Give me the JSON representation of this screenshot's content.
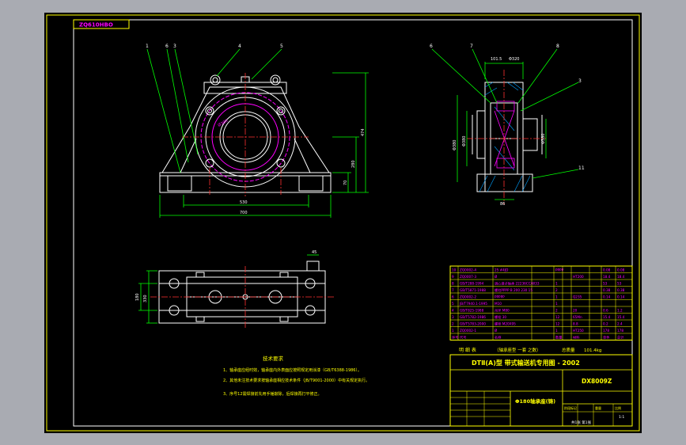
{
  "drawing_code": "ZQ610HBO",
  "colors": {
    "paper": "#000000",
    "outline": "#ffffff",
    "frame": "#ffff00",
    "label": "#ff00ff",
    "centerline": "#ff3030",
    "hatch": "#00a0ff",
    "leader": "#00ff00"
  },
  "front_view": {
    "callouts": [
      "1",
      "6",
      "3",
      "4",
      "5"
    ],
    "dims": {
      "width_base": "700",
      "width_bolt": "530",
      "height_total": "474",
      "height_center": "280",
      "height_base": "70",
      "bore": "Ø380"
    }
  },
  "side_view": {
    "callouts": [
      "6",
      "7",
      "8",
      "3",
      "11"
    ],
    "dims": {
      "top_a": "101.5",
      "top_b": "Φ320",
      "left_a": "Φ380",
      "left_b": "Φ380",
      "right": "Φ380",
      "bottom": "86"
    }
  },
  "top_view": {
    "dims": {
      "top": "45",
      "left_a": "330",
      "left_b": "180"
    }
  },
  "notes": {
    "title": "技术要求",
    "items": [
      "1、轴承座应经时效，轴承座内外表面应按照规定用涂漆（GB/T6388-1986）。",
      "2、其他未注技术要求按轴承座相应技术条件（JB/T9001-2000）中有关规定执行。",
      "3、序号12需焊接前先用手锤敲除，后焊接再打平修正。"
    ]
  },
  "bom": {
    "rows": [
      [
        "10",
        "ZQ0002-4",
        "25 #4JD",
        "",
        "PPPP",
        "",
        "",
        "0.08",
        "0.08"
      ],
      [
        "9",
        "ZQ0007-3",
        "Ø",
        "",
        "",
        "",
        "HT200",
        "18.4",
        "18.4"
      ],
      [
        "8",
        "GB/T288-1994",
        "调心滚子轴承 22236CC/W33",
        "",
        "1",
        "",
        "",
        "53",
        "53"
      ],
      [
        "7",
        "GB/T5871-1988",
        "螺柱PPPP B 200 230 15",
        "",
        "2",
        "",
        "",
        "0.38",
        "0.38"
      ],
      [
        "6",
        "ZQ0002-2",
        "PPPPP",
        "",
        "1",
        "",
        "Q235",
        "0.14",
        "0.14"
      ],
      [
        "5",
        "JB/T7940.1-1995",
        "M10",
        "",
        "1",
        "",
        "",
        "",
        ""
      ],
      [
        "4",
        "GB/T825-1988",
        "吊环 M80",
        "",
        "2",
        "",
        "20",
        "0.6",
        "1.2"
      ],
      [
        "3",
        "GB/T5782-1986",
        "螺栓 30",
        "",
        "12",
        "",
        "65Mn",
        "15.4",
        "15.4"
      ],
      [
        "2",
        "GB/T5783-2000",
        "螺栓 M20X95",
        "",
        "12",
        "",
        "8.8",
        "0.2",
        "2.4"
      ],
      [
        "1",
        "ZQ0002-1",
        "Ø",
        "",
        "1",
        "",
        "HT250",
        "178",
        "178"
      ],
      [
        "序号",
        "代号",
        "名称",
        "",
        "数量",
        "",
        "材料",
        "单件",
        "总计"
      ]
    ],
    "header_label": "明 细 表",
    "header_note": "（轴承座型 一套 之数）",
    "weight_label": "总质量",
    "weight_value": "101.4kg"
  },
  "title_block": {
    "series": "DTⅡ(A)型  带式输送机专用图 - 2002",
    "drawing_no": "DX8009Z",
    "part_name": "Φ180轴承座(铸)",
    "scale": "1:1",
    "sheet_info": "共1张 第1张",
    "stage": "阶段标记",
    "weight": "重量",
    "ratio": "比例"
  }
}
